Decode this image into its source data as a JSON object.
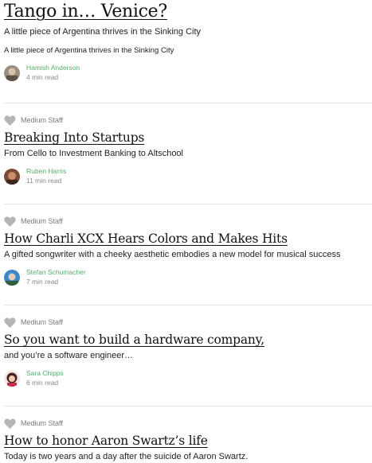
{
  "posts": [
    {
      "title": "Tango in… Venice?",
      "subtitle": "A little piece of Argentina thrives in the Sinking City",
      "snippet": "A little piece of Argentina thrives in the Sinking City",
      "author": "Hamish Anderson",
      "read_time": "4 min read"
    },
    {
      "recommended_by": "Medium Staff",
      "title": "Breaking Into Startups",
      "subtitle": "From Cello to Investment Banking to Altschool",
      "author": "Ruben Harris",
      "read_time": "11 min read"
    },
    {
      "recommended_by": "Medium Staff",
      "title": "How Charli XCX Hears Colors and Makes Hits",
      "subtitle": "A gifted songwriter with a cheeky aesthetic embodies a new model for musical success",
      "author": "Stefan Schumacher",
      "read_time": "7 min read"
    },
    {
      "recommended_by": "Medium Staff",
      "title": "So you want to build a hardware company,",
      "subtitle": "and you’re a software engineer…",
      "author": "Sara Chipps",
      "read_time": "6 min read"
    },
    {
      "recommended_by": "Medium Staff",
      "title": "How to honor Aaron Swartz’s life",
      "subtitle": "Today is two years and a day after the suicide of Aaron Swartz."
    }
  ],
  "colors": {
    "author_link": "#57ad68",
    "meta_gray": "#8a8a8a",
    "divider": "#e3e3e3",
    "heart": "#b5b5b5"
  },
  "icons": {
    "recommend": "heart-icon"
  }
}
